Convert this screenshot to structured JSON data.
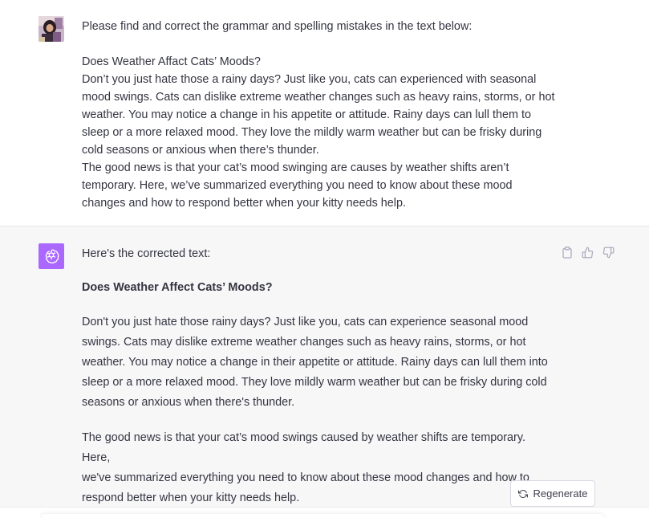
{
  "user_message": {
    "intro": "Please find and correct the grammar and spelling mistakes in the text below:",
    "title": "Does Weather Affact Cats’ Moods?",
    "body_lines": [
      "Don’t you just hate those a rainy days? Just like you, cats can experienced with seasonal",
      "mood swings. Cats can dislike extreme weather changes such as heavy rains, storms, or hot",
      "weather. You may notice a change in his appetite or attitude. Rainy days can lull them to",
      "sleep or a more relaxed mood. They love the mildly warm weather but can be frisky during",
      "cold seasons or anxious when there’s thunder.",
      "The good news is that your cat’s mood swinging are causes by weather shifts aren’t",
      "temporary. Here, we’ve summarized everything you need to know about these mood",
      "changes and how to respond better when your kitty needs help."
    ]
  },
  "assistant_message": {
    "intro": "Here's the corrected text:",
    "title": "Does Weather Affect Cats’ Moods?",
    "paragraph1_lines": [
      "Don't you just hate those rainy days? Just like you, cats can experience seasonal mood",
      "swings. Cats may dislike extreme weather changes such as heavy rains, storms, or hot",
      "weather. You may notice a change in their appetite or attitude. Rainy days can lull them into",
      "sleep or a more relaxed mood. They love mildly warm weather but can be frisky during cold",
      "seasons or anxious when there's thunder."
    ],
    "paragraph2_lines": [
      "The good news is that your cat’s mood swings caused by weather shifts are temporary. Here,",
      "we've summarized everything you need to know about these mood changes and how to",
      "respond better when your kitty needs help."
    ]
  },
  "actions": {
    "copy_icon": "clipboard-icon",
    "like_icon": "thumbs-up-icon",
    "dislike_icon": "thumbs-down-icon"
  },
  "regenerate": {
    "label": "Regenerate",
    "icon": "refresh-icon"
  },
  "colors": {
    "bot_avatar": "#ab68ff",
    "assistant_bg": "#f7f7f8",
    "text": "#343541"
  }
}
